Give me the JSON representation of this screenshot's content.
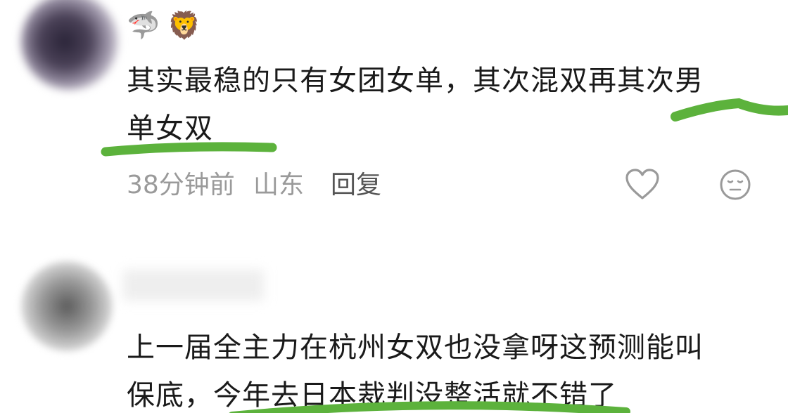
{
  "comments": [
    {
      "emojis": [
        "🦈",
        "🦁"
      ],
      "text_line1": "其实最稳的只有女团女单，其次混双再其次男",
      "text_line2": "单女双",
      "time": "38分钟前",
      "location": "山东",
      "reply_label": "回复"
    },
    {
      "text_line1": "上一届全主力在杭州女双也没拿呀这预测能叫",
      "text_line2": "保底，今年去日本裁判没整活就不错了"
    }
  ],
  "colors": {
    "highlight": "#5cb23c",
    "meta_text": "#9a9a9a"
  }
}
